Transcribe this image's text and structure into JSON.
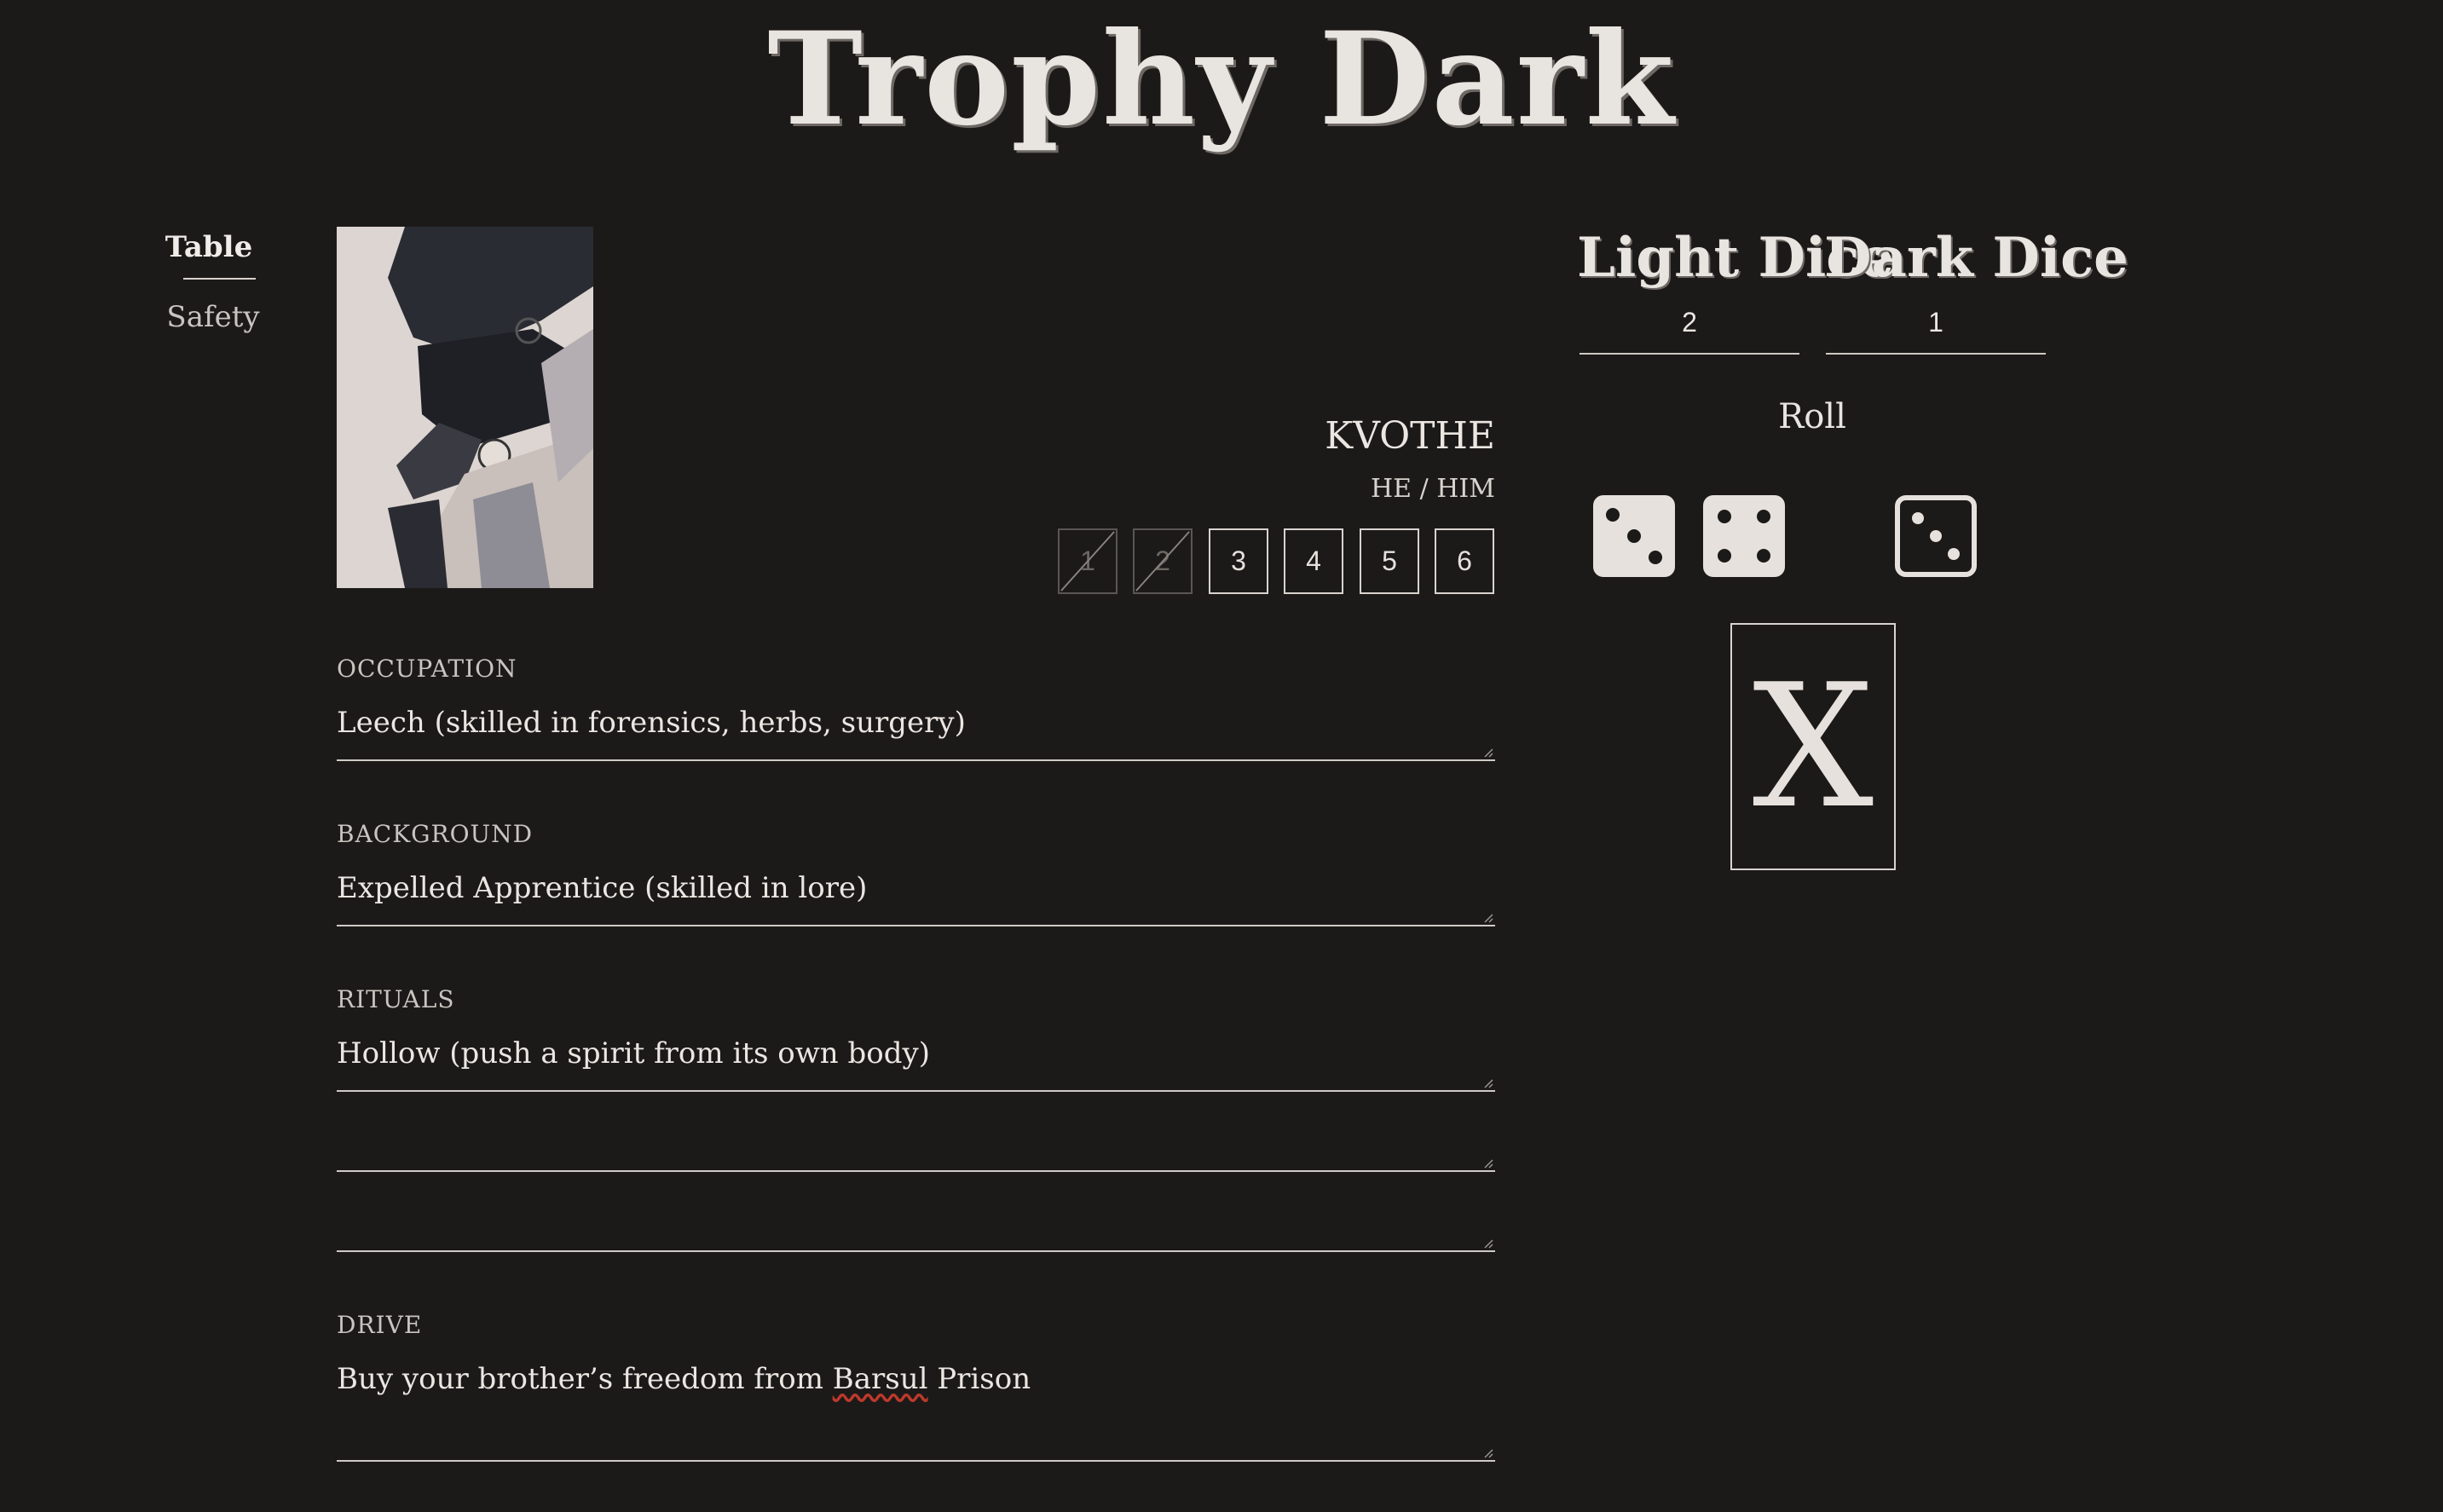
{
  "header": {
    "title": "Trophy Dark"
  },
  "nav": {
    "items": [
      "Table",
      "Safety"
    ]
  },
  "character": {
    "name": "KVOTHE",
    "pronouns": "HE / HIM",
    "ruin_boxes": [
      "1",
      "2",
      "3",
      "4",
      "5",
      "6"
    ],
    "ruin_marked": 2
  },
  "fields": {
    "occupation": {
      "label": "OCCUPATION",
      "value": "Leech (skilled in forensics, herbs, surgery)"
    },
    "background": {
      "label": "BACKGROUND",
      "value": "Expelled Apprentice (skilled in lore)"
    },
    "rituals": {
      "label": "RITUALS",
      "values": [
        "Hollow (push a spirit from its own body)",
        "",
        ""
      ]
    },
    "drive": {
      "label": "DRIVE",
      "value_before": "Buy your brother’s freedom from ",
      "value_misspelled": "Barsul",
      "value_after": " Prison"
    }
  },
  "dice": {
    "light_label": "Light Dice",
    "light_count": "2",
    "dark_label": "Dark Dice",
    "dark_count": "1",
    "roll_label": "Roll",
    "light_results": [
      3,
      4
    ],
    "dark_results": [
      3
    ],
    "result_symbol": "X"
  }
}
